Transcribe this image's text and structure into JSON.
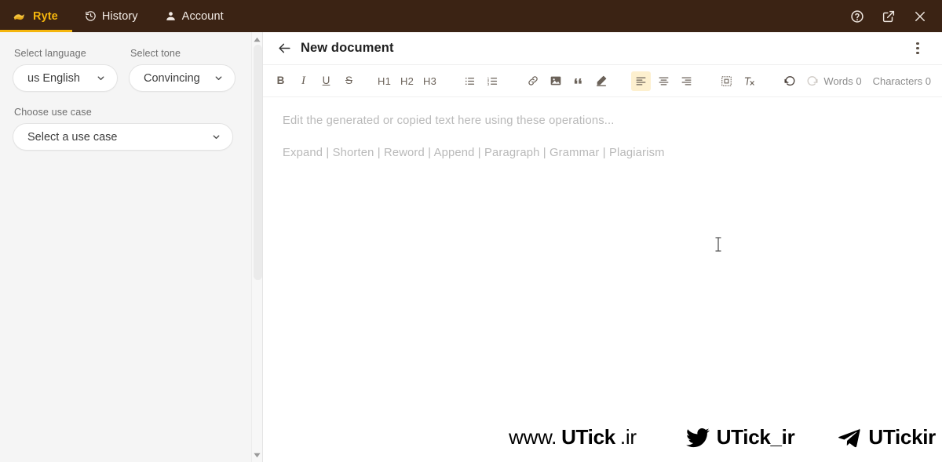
{
  "app": {
    "topbar_bg": "#3b2314",
    "accent": "#f5b60d"
  },
  "topbar": {
    "tabs": [
      {
        "label": "Ryte",
        "icon": "ryte-logo-icon",
        "active": true
      },
      {
        "label": "History",
        "icon": "history-clock-icon",
        "active": false
      },
      {
        "label": "Account",
        "icon": "account-person-icon",
        "active": false
      }
    ],
    "actions": [
      {
        "name": "help-icon",
        "title": "Help"
      },
      {
        "name": "open-external-icon",
        "title": "Open in new window"
      },
      {
        "name": "close-icon",
        "title": "Close"
      }
    ]
  },
  "sidebar": {
    "language": {
      "label": "Select language",
      "value": "us English",
      "chevron": "chevron-down-icon"
    },
    "tone": {
      "label": "Select tone",
      "value": "Convincing",
      "chevron": "chevron-down-icon"
    },
    "use_case": {
      "label": "Choose use case",
      "value": "Select a use case",
      "placeholder": "Select a use case",
      "chevron": "chevron-down-icon"
    }
  },
  "document": {
    "back_icon": "arrow-left-icon",
    "title": "New document",
    "menu_icon": "more-vertical-icon"
  },
  "toolbar": {
    "bold": "B",
    "italic": "I",
    "underline": "U",
    "strikethrough": "S",
    "h1": "H1",
    "h2": "H2",
    "h3": "H3",
    "bullet_list": "bulleted-list-icon",
    "numbered_list": "numbered-list-icon",
    "link": "link-icon",
    "image": "image-icon",
    "quote": "quote-icon",
    "highlight": "pen-highlight-icon",
    "align_left": "align-left-icon",
    "align_center": "align-center-icon",
    "align_right": "align-right-icon",
    "insert_box": "insert-frame-icon",
    "clear_format": "clear-formatting-icon",
    "undo": "undo-icon",
    "redo": "redo-icon",
    "active_button": "align-left-icon",
    "disabled_button": "redo-icon",
    "active_bg": "#fdf0cf",
    "words_label": "Words 0",
    "characters_label": "Characters 0"
  },
  "editor": {
    "placeholder": "Edit the generated or copied text here using these operations...",
    "operations_line": "Expand | Shorten | Reword | Append | Paragraph | Grammar | Plagiarism",
    "cursor": "text-ibeam-cursor"
  },
  "watermark": {
    "site_prefix": "www.",
    "site_name": "UTick",
    "site_tld": ".ir",
    "twitter_handle": "UTick_ir",
    "twitter_icon": "twitter-bird-icon",
    "telegram_handle": "UTickir",
    "telegram_icon": "telegram-plane-icon"
  }
}
